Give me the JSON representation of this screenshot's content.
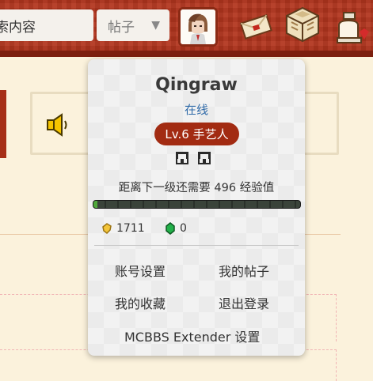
{
  "header": {
    "search_text": "索内容",
    "search_scope": "帖子",
    "search_scope_arrow": "▼"
  },
  "profile_popup": {
    "username": "Qingraw",
    "status": "在线",
    "level_badge": "Lv.6 手艺人",
    "exp_text": "距离下一级还需要 496 经验值",
    "exp_progress": 0.02,
    "gold": "1711",
    "emerald": "0",
    "menu": {
      "account_settings": "账号设置",
      "my_posts": "我的帖子",
      "my_favorites": "我的收藏",
      "logout": "退出登录",
      "extender_settings": "MCBBS Extender 设置"
    }
  },
  "colors": {
    "header_red": "#b3361e",
    "badge_red": "#a22b12",
    "online_blue": "#2f6aa8",
    "page_bg": "#fbf2dc"
  },
  "icons": [
    "message-letter-icon",
    "crafting-box-icon",
    "bell-icon",
    "speaker-icon",
    "gold-nugget-icon",
    "emerald-icon",
    "medal-icon"
  ]
}
